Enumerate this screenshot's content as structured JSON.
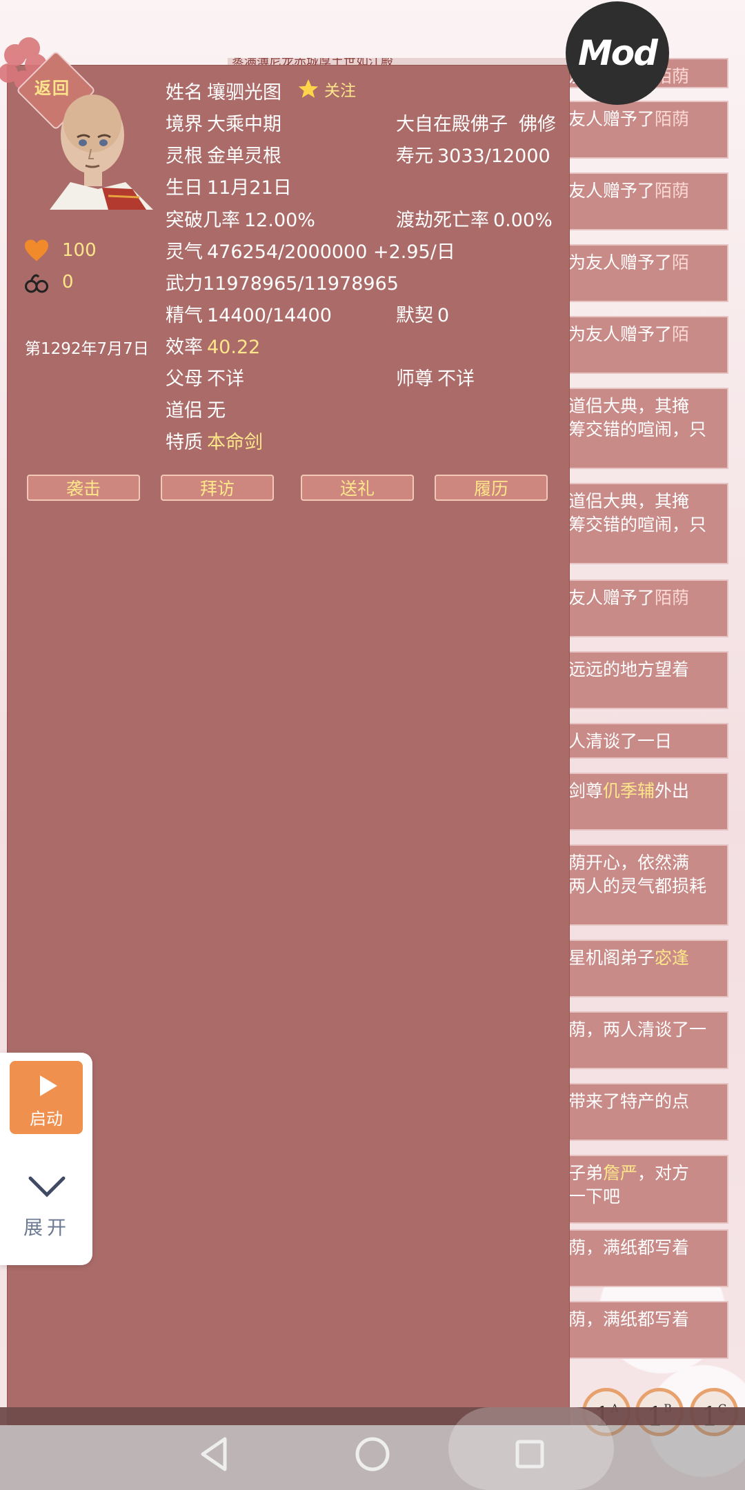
{
  "header": {
    "back_label": "返回",
    "follow_label": "关注",
    "mod_label": "Mod",
    "top_strip_text": "蒸满薄尼龙赤城厚土世如江殿"
  },
  "profile": {
    "name_label": "姓名",
    "name": "壤驷光图",
    "realm_label": "境界",
    "realm": "大乘中期",
    "sect": "大自在殿佛子",
    "path": "佛修",
    "root_label": "灵根",
    "root": "金单灵根",
    "life_label": "寿元",
    "life": "3033/12000",
    "birthday_label": "生日",
    "birthday": "11月21日",
    "breakthrough_label": "突破几率",
    "breakthrough": "12.00%",
    "tribulation_label": "渡劫死亡率",
    "tribulation": "0.00%",
    "qi_label": "灵气",
    "qi": "476254/2000000 +2.95/日",
    "force_label": "武力",
    "force": "11978965/11978965",
    "essence_label": "精气",
    "essence": "14400/14400",
    "bond_label": "默契",
    "bond": "0",
    "efficiency_label": "效率",
    "efficiency": "40.22",
    "parents_label": "父母",
    "parents": "不详",
    "master_label": "师尊",
    "master": "不详",
    "partner_label": "道侣",
    "partner": "无",
    "trait_label": "特质",
    "trait": "本命剑"
  },
  "stats": {
    "favor": "100",
    "shackles": "0",
    "date": "第1292年7月7日"
  },
  "actions": [
    "袭击",
    "拜访",
    "送礼",
    "履历"
  ],
  "side_widget": {
    "start_label": "启动",
    "expand_label": "展开"
  },
  "speed_buttons": [
    {
      "num": "1",
      "sup": "A"
    },
    {
      "num": "1",
      "sup": "B"
    },
    {
      "num": "1",
      "sup": "C"
    }
  ],
  "log": [
    {
      "text": "友人赠予了",
      "hl": "陌荫"
    },
    {
      "text": "友人赠予了",
      "hl": "陌荫"
    },
    {
      "text": "为友人赠予了",
      "hl": "陌"
    },
    {
      "text": "为友人赠予了",
      "hl": "陌"
    },
    {
      "text": "道侣大典，其掩\n筹交错的喧闹，只",
      "hl": ""
    },
    {
      "text": "道侣大典，其掩\n筹交错的喧闹，只",
      "hl": ""
    },
    {
      "text": "友人赠予了",
      "hl": "陌荫"
    },
    {
      "text": "远远的地方望着",
      "hl": ""
    },
    {
      "text": "人清谈了一日",
      "hl": ""
    },
    {
      "text": "剑尊",
      "hy": "仉季辅",
      "tail": "外出"
    },
    {
      "text": "荫开心，依然满\n两人的灵气都损耗",
      "hl": ""
    },
    {
      "text": "星机阁弟子",
      "hy": "宓逢"
    },
    {
      "text": "荫，两人清谈了一",
      "hl": ""
    },
    {
      "text": "带来了特产的点",
      "hl": ""
    },
    {
      "text": "子弟",
      "hy": "詹严",
      "tail": "，对方\n一下吧"
    },
    {
      "text": "荫，满纸都写着",
      "hl": ""
    },
    {
      "text": "荫，满纸都写着",
      "hl": ""
    }
  ],
  "colors": {
    "panel": "#ab6c69",
    "accent_yellow": "#ffe68a",
    "orange": "#f0904f"
  }
}
